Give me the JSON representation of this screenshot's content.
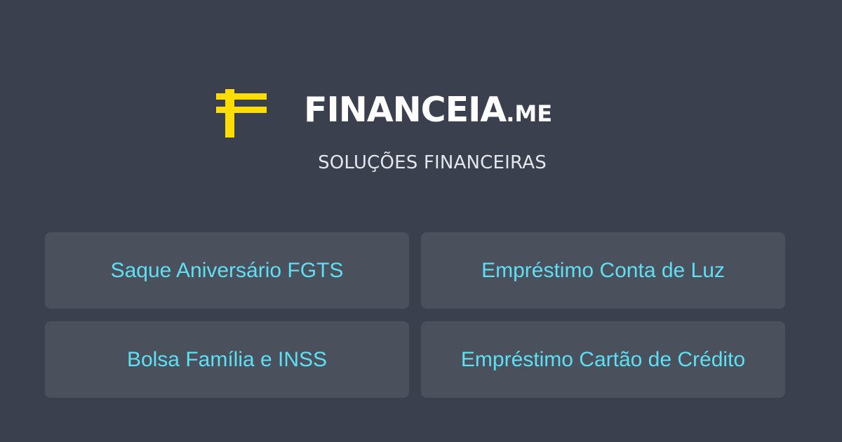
{
  "header": {
    "logo_icon": "stylized-f-icon",
    "brand_name": "FINANCEIA",
    "brand_tld": ".ME",
    "tagline": "SOLUÇÕES FINANCEIRAS"
  },
  "links": [
    {
      "label": "Saque Aniversário FGTS"
    },
    {
      "label": "Empréstimo Conta de Luz"
    },
    {
      "label": "Bolsa Família e INSS"
    },
    {
      "label": "Empréstimo Cartão de Crédito"
    }
  ],
  "colors": {
    "background": "#3a404d",
    "card_background": "#4a505c",
    "accent_yellow": "#ffdd00",
    "link_text": "#5ee0f4",
    "brand_text": "#ffffff"
  }
}
